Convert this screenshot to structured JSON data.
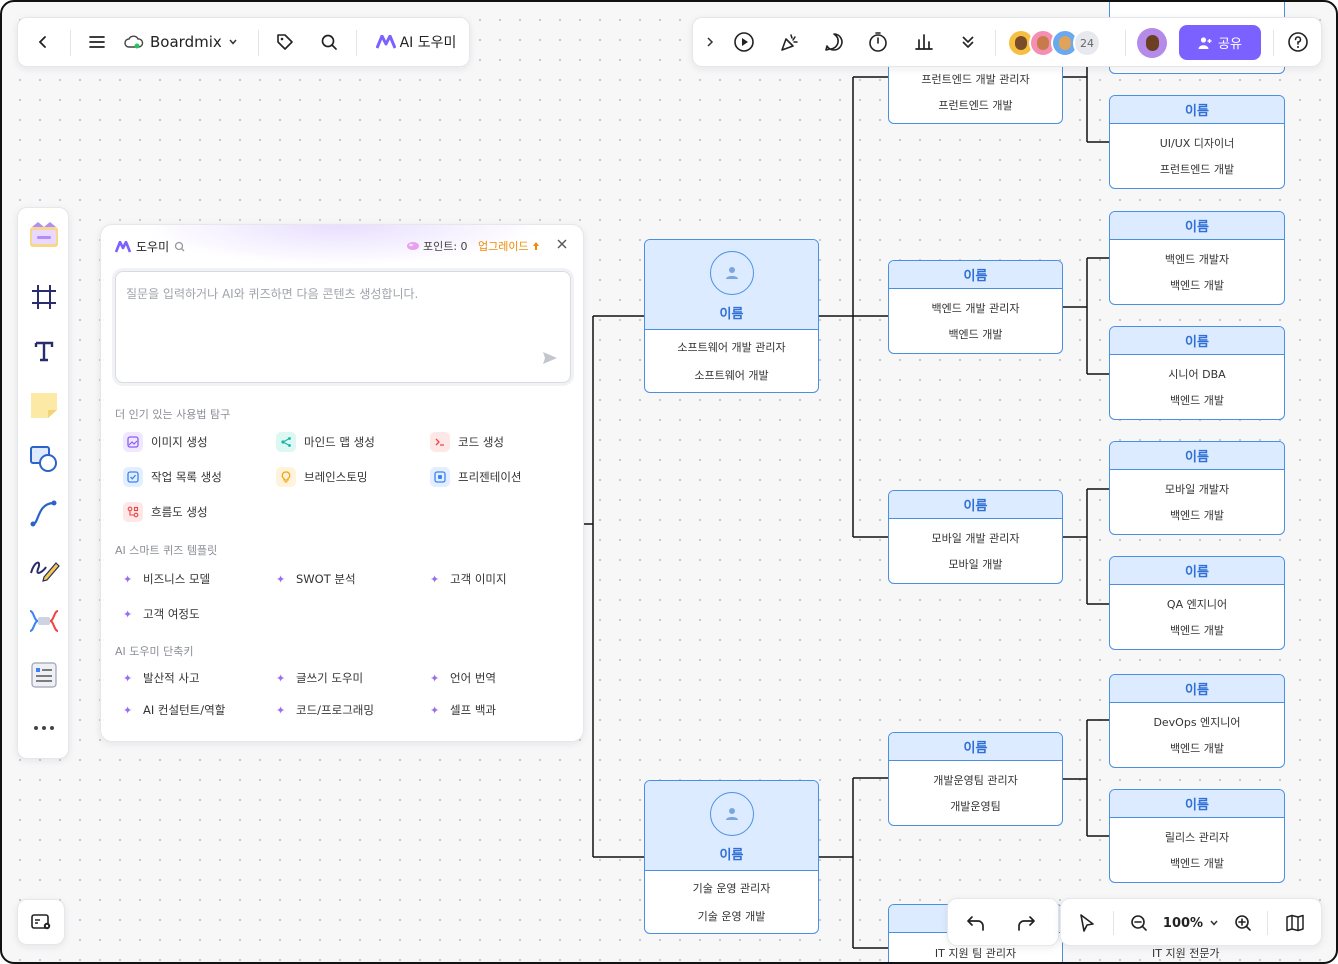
{
  "topbar": {
    "app_name": "Boardmix",
    "ai_helper_label": "AI 도우미",
    "collaborator_count": "24",
    "share_label": "공유"
  },
  "ai_panel": {
    "title": "도우미",
    "points_label": "포인트: 0",
    "upgrade_label": "업그레이드",
    "input_placeholder": "질문을 입력하거나 AI와 퀴즈하면 다음 콘텐츠 생성합니다.",
    "section_popular": "더 인기 있는 사용법 탐구",
    "popular_items": [
      {
        "label": "이미지 생성",
        "icon": "image-icon",
        "color": "#8b5cf6",
        "bg": "#efe8ff"
      },
      {
        "label": "마인드 맵 생성",
        "icon": "mindmap-icon",
        "color": "#14b8a6",
        "bg": "#ddf7f3"
      },
      {
        "label": "코드 생성",
        "icon": "code-icon",
        "color": "#ef4444",
        "bg": "#fde7e7"
      },
      {
        "label": "작업 목록 생성",
        "icon": "checklist-icon",
        "color": "#3b82f6",
        "bg": "#e3efff"
      },
      {
        "label": "브레인스토밍",
        "icon": "lightbulb-icon",
        "color": "#f59e0b",
        "bg": "#fff3dc"
      },
      {
        "label": "프리젠테이션",
        "icon": "presentation-icon",
        "color": "#3b82f6",
        "bg": "#e3efff"
      },
      {
        "label": "흐름도 생성",
        "icon": "flowchart-icon",
        "color": "#ef4444",
        "bg": "#fde7e7"
      }
    ],
    "section_quiz": "AI 스마트 퀴즈 템플릿",
    "quiz_items": [
      "비즈니스 모델",
      "SWOT 분석",
      "고객 이미지",
      "고객 여정도"
    ],
    "section_shortcuts": "AI 도우미 단축키",
    "shortcut_items": [
      "발산적 사고",
      "글쓰기 도우미",
      "언어 번역",
      "AI 컨설턴트/역할",
      "코드/프로그래밍",
      "셀프 백과"
    ]
  },
  "org_chart": {
    "big_nodes": [
      {
        "name": "이름",
        "role": "소프트웨어 개발 관리자",
        "dept": "소프트웨어 개발"
      },
      {
        "name": "이름",
        "role": "기술 운영 관리자",
        "dept": "기술 운영 개발"
      }
    ],
    "mid_nodes": [
      {
        "name": "",
        "role": "프런트엔드 개발 관리자",
        "dept": "프런트엔드 개발"
      },
      {
        "name": "이름",
        "role": "백엔드 개발 관리자",
        "dept": "백엔드 개발"
      },
      {
        "name": "이름",
        "role": "모바일 개발 관리자",
        "dept": "모바일 개발"
      },
      {
        "name": "이름",
        "role": "개발운영팀 관리자",
        "dept": "개발운영팀"
      },
      {
        "name": "",
        "role": "IT 지원 팀 관리자",
        "dept": ""
      }
    ],
    "leaf_nodes": [
      {
        "name": "이름",
        "role": "UI/UX 디자이너",
        "dept": "프런트엔드 개발"
      },
      {
        "name": "이름",
        "role": "백엔드 개발자",
        "dept": "백엔드 개발"
      },
      {
        "name": "이름",
        "role": "시니어 DBA",
        "dept": "백엔드 개발"
      },
      {
        "name": "이름",
        "role": "모바일 개발자",
        "dept": "백엔드 개발"
      },
      {
        "name": "이름",
        "role": "QA 엔지니어",
        "dept": "백엔드 개발"
      },
      {
        "name": "이름",
        "role": "DevOps 엔지니어",
        "dept": "백엔드 개발"
      },
      {
        "name": "이름",
        "role": "릴리스 관리자",
        "dept": "백엔드 개발"
      },
      {
        "name": "",
        "role": "IT 지원 전문가",
        "dept": ""
      }
    ]
  },
  "bottom_bar": {
    "zoom_level": "100%"
  },
  "colors": {
    "accent": "#7b61ff",
    "node_border": "#4a90e2",
    "node_fill": "#dcebff",
    "upgrade": "#f08a00"
  }
}
